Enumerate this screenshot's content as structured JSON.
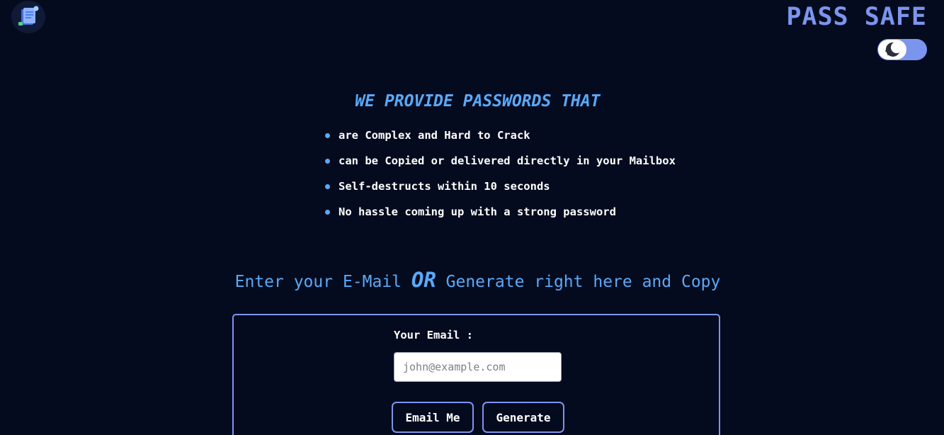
{
  "header": {
    "logo_icon": "notepad-icon",
    "brand": "PASS SAFE",
    "theme_toggle_icon": "moon-icon"
  },
  "hero": {
    "tagline": "WE PROVIDE PASSWORDS THAT",
    "features": [
      "are Complex and Hard to Crack",
      "can be Copied or delivered directly in your Mailbox",
      "Self-destructs within 10 seconds",
      "No hassle coming up with a strong password"
    ]
  },
  "cta": {
    "part1": "Enter your E-Mail ",
    "or": "OR",
    "part2": " Generate right here and Copy"
  },
  "form": {
    "email_label": "Your Email :",
    "email_placeholder": "john@example.com",
    "email_value": "",
    "email_button": "Email Me",
    "generate_button": "Generate"
  },
  "colors": {
    "background": "#050b1e",
    "accent": "#7b95ef",
    "highlight": "#5aa9f8"
  }
}
